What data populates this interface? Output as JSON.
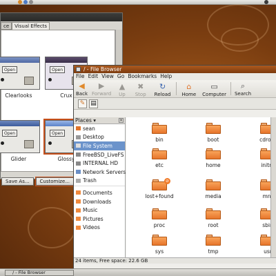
{
  "appearance": {
    "tabs": [
      "ce",
      "Visual Effects"
    ],
    "themes": [
      {
        "name": "Clearlooks",
        "button": "Open",
        "selected": false
      },
      {
        "name": "Crux",
        "button": "Open",
        "selected": false
      },
      {
        "name": "Glider",
        "button": "Open",
        "selected": false
      },
      {
        "name": "Glossy",
        "button": "Open",
        "selected": true
      }
    ],
    "buttons": {
      "save_as": "Save As...",
      "customize": "Customize..."
    }
  },
  "file_browser": {
    "title": "/ - File Browser",
    "menu": [
      "File",
      "Edit",
      "View",
      "Go",
      "Bookmarks",
      "Help"
    ],
    "toolbar": [
      {
        "label": "Back",
        "icon": "back-arrow-icon",
        "enabled": true
      },
      {
        "label": "Forward",
        "icon": "forward-arrow-icon",
        "enabled": false
      },
      {
        "label": "Up",
        "icon": "up-arrow-icon",
        "enabled": false
      },
      {
        "label": "Stop",
        "icon": "stop-icon",
        "enabled": false
      },
      {
        "label": "Reload",
        "icon": "reload-icon",
        "enabled": true
      },
      {
        "label": "Home",
        "icon": "home-icon",
        "enabled": true
      },
      {
        "label": "Computer",
        "icon": "computer-icon",
        "enabled": true
      },
      {
        "label": "Search",
        "icon": "search-icon",
        "enabled": true
      }
    ],
    "places_title": "Places",
    "places": [
      {
        "label": "sean",
        "icon": "home-folder-icon",
        "selected": false
      },
      {
        "label": "Desktop",
        "icon": "desktop-icon",
        "selected": false
      },
      {
        "label": "File System",
        "icon": "filesystem-icon",
        "selected": true
      },
      {
        "label": "FreeBSD_LiveFS",
        "icon": "drive-icon",
        "selected": false
      },
      {
        "label": "INTERNAL HD",
        "icon": "drive-icon",
        "selected": false
      },
      {
        "label": "Network Servers",
        "icon": "network-icon",
        "selected": false
      },
      {
        "label": "Trash",
        "icon": "trash-icon",
        "selected": false
      }
    ],
    "bookmarks": [
      {
        "label": "Documents",
        "icon": "folder-icon"
      },
      {
        "label": "Downloads",
        "icon": "folder-icon"
      },
      {
        "label": "Music",
        "icon": "folder-icon"
      },
      {
        "label": "Pictures",
        "icon": "folder-icon"
      },
      {
        "label": "Videos",
        "icon": "folder-icon"
      }
    ],
    "files": [
      "bin",
      "boot",
      "cdrom",
      "etc",
      "home",
      "initrd",
      "lost+found",
      "media",
      "mnt",
      "proc",
      "root",
      "sbin",
      "sys",
      "tmp",
      "usr"
    ],
    "status": "24 items, Free space: 22.6 GB"
  },
  "taskbar": {
    "task": "/ - File Browser"
  },
  "colors": {
    "accent": "#c64f1a",
    "folder": "#f08a3e",
    "selection": "#6b93cb"
  }
}
